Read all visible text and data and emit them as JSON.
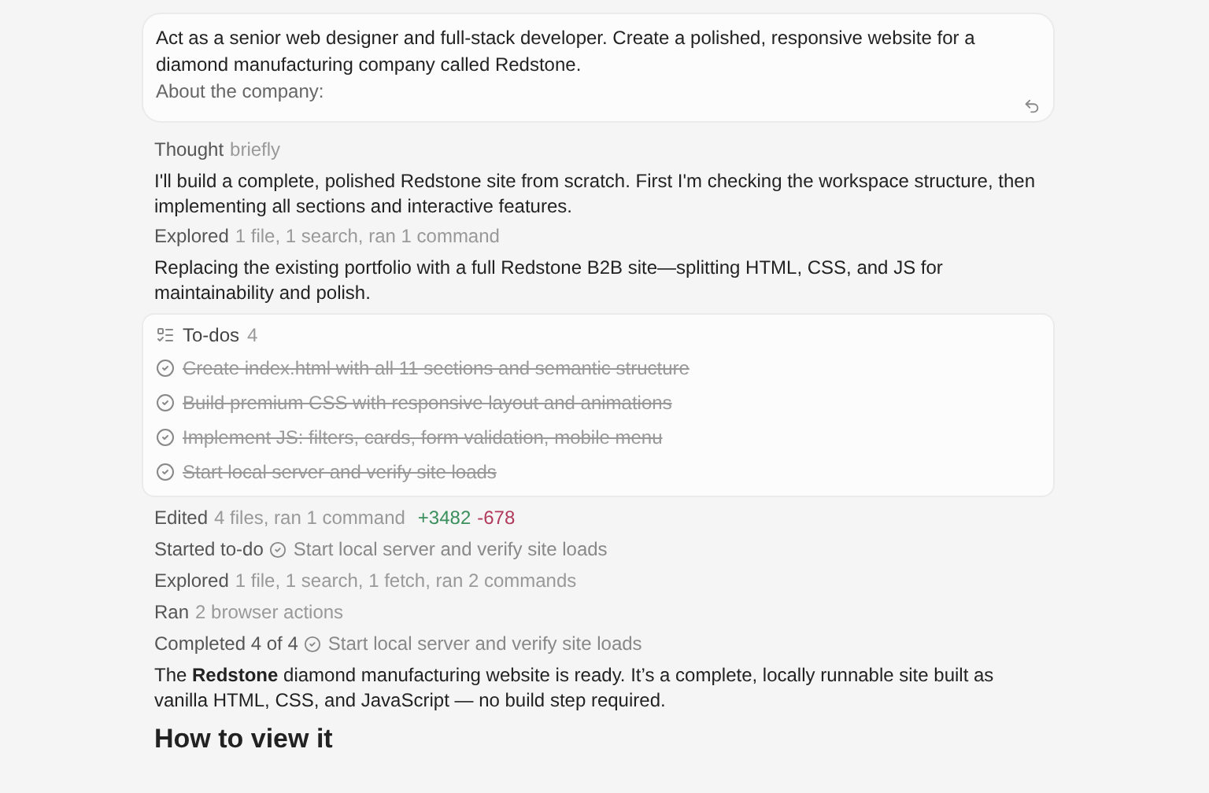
{
  "prompt": {
    "text": "Act as a senior web designer and full-stack developer. Create a polished, responsive website for a diamond manufacturing company called Redstone.",
    "subtext": "About the company:"
  },
  "activity": [
    {
      "kind": "status",
      "label": "Thought",
      "detail": "briefly"
    },
    {
      "kind": "message",
      "text": "I'll build a complete, polished Redstone site from scratch. First I'm checking the workspace structure, then implementing all sections and interactive features."
    },
    {
      "kind": "status",
      "label": "Explored",
      "detail": "1 file, 1 search, ran 1 command"
    },
    {
      "kind": "message",
      "text": "Replacing the existing portfolio with a full Redstone B2B site—splitting HTML, CSS, and JS for maintainability and polish."
    },
    {
      "kind": "todos",
      "title": "To-dos",
      "count": "4",
      "items": [
        {
          "text": "Create index.html with all 11 sections and semantic structure",
          "done": true
        },
        {
          "text": "Build premium CSS with responsive layout and animations",
          "done": true
        },
        {
          "text": "Implement JS: filters, cards, form validation, mobile menu",
          "done": true
        },
        {
          "text": "Start local server and verify site loads",
          "done": true
        }
      ]
    },
    {
      "kind": "diff",
      "label": "Edited",
      "detail": "4 files, ran 1 command",
      "added": "+3482",
      "removed": "-678"
    },
    {
      "kind": "todo_status",
      "label": "Started to-do",
      "task": "Start local server and verify site loads"
    },
    {
      "kind": "status",
      "label": "Explored",
      "detail": "1 file, 1 search, 1 fetch, ran 2 commands"
    },
    {
      "kind": "status",
      "label": "Ran",
      "detail": "2 browser actions"
    },
    {
      "kind": "todo_status",
      "label": "Completed 4 of 4",
      "task": "Start local server and verify site loads"
    },
    {
      "kind": "message",
      "text": "The **Redstone** diamond manufacturing website is ready. It’s a complete, locally runnable site built as vanilla HTML, CSS, and JavaScript — no build step required."
    },
    {
      "kind": "heading",
      "text": "How to view it"
    }
  ]
}
